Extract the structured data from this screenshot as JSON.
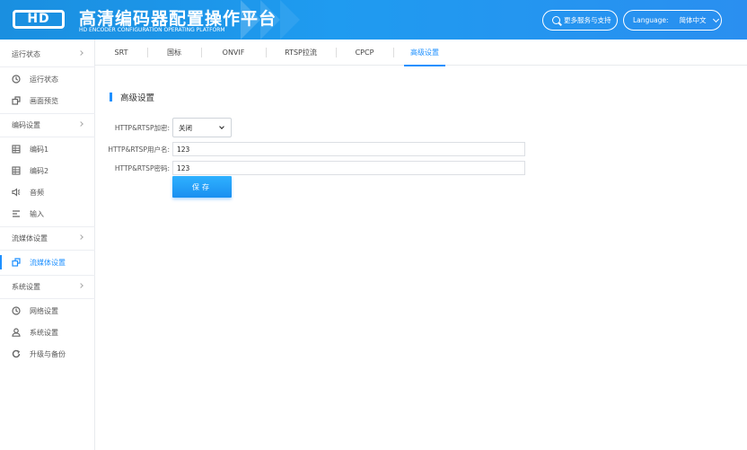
{
  "header": {
    "logo_text": "HD",
    "title_cn": "高清编码器配置操作平台",
    "title_en": "HD ENCODER CONFIGURATION OPERATING PLATFORM",
    "service_label": "更多服务与支持",
    "language_label": "Language:",
    "language_value": "简体中文"
  },
  "sidebar": {
    "groups": [
      {
        "label": "运行状态",
        "items": [
          {
            "label": "运行状态",
            "icon": "clock-icon"
          },
          {
            "label": "画面预览",
            "icon": "preview-icon"
          }
        ]
      },
      {
        "label": "编码设置",
        "items": [
          {
            "label": "编码1",
            "icon": "grid-icon"
          },
          {
            "label": "编码2",
            "icon": "grid-icon"
          },
          {
            "label": "音频",
            "icon": "speaker-icon"
          },
          {
            "label": "输入",
            "icon": "input-icon"
          }
        ]
      },
      {
        "label": "流媒体设置",
        "items": [
          {
            "label": "流媒体设置",
            "icon": "stream-icon",
            "active": true
          }
        ]
      },
      {
        "label": "系统设置",
        "items": [
          {
            "label": "网络设置",
            "icon": "network-icon"
          },
          {
            "label": "系统设置",
            "icon": "user-icon"
          },
          {
            "label": "升级与备份",
            "icon": "refresh-icon"
          }
        ]
      }
    ]
  },
  "tabs": [
    {
      "label": "SRT"
    },
    {
      "label": "国标"
    },
    {
      "label": "ONVIF"
    },
    {
      "label": "RTSP拉流"
    },
    {
      "label": "CPCP"
    },
    {
      "label": "高级设置",
      "active": true
    }
  ],
  "section": {
    "title": "高级设置"
  },
  "form": {
    "encrypt_label": "HTTP&RTSP加密:",
    "encrypt_value": "关闭",
    "username_label": "HTTP&RTSP用户名:",
    "username_value": "123",
    "password_label": "HTTP&RTSP密码:",
    "password_value": "123",
    "save_label": "保存"
  },
  "colors": {
    "accent": "#1e90ff",
    "header": "#1f9bf0"
  }
}
